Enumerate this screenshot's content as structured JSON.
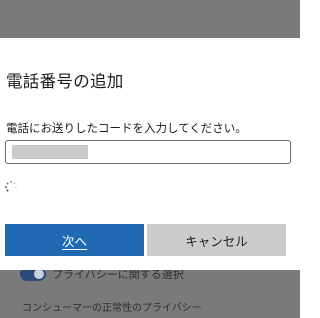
{
  "dialog": {
    "title": "電話番号の追加",
    "prompt": "電話にお送りしたコードを入力してください。",
    "next_label": "次へ",
    "cancel_label": "キャンセル"
  },
  "background": {
    "privacy_choices": "プライバシーに関する選択",
    "health_privacy": "コンシューマーの正常性のプライバシー"
  },
  "colors": {
    "primary": "#1f6ab3",
    "secondary": "#cccccc",
    "overlay": "#7a7a7a"
  }
}
